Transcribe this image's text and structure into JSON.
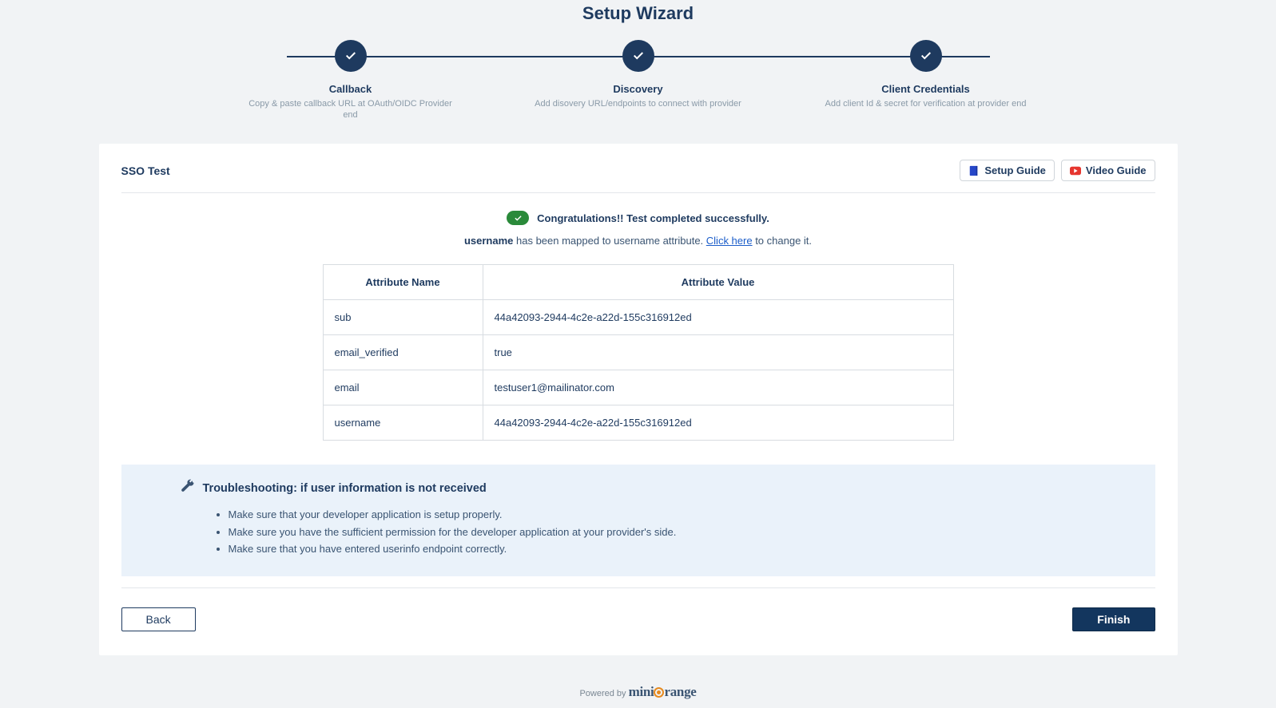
{
  "wizard": {
    "title": "Setup Wizard",
    "steps": [
      {
        "title": "Callback",
        "desc": "Copy & paste callback URL at OAuth/OIDC Provider end"
      },
      {
        "title": "Discovery",
        "desc": "Add disovery URL/endpoints to connect with provider"
      },
      {
        "title": "Client Credentials",
        "desc": "Add client Id & secret for verification at provider end"
      }
    ]
  },
  "panel": {
    "title": "SSO Test",
    "setup_guide_label": "Setup Guide",
    "video_guide_label": "Video Guide",
    "success_text": "Congratulations!! Test completed successfully.",
    "mapping_prefix_bold": "username",
    "mapping_middle": " has been mapped to username attribute. ",
    "mapping_link": "Click here",
    "mapping_suffix": " to change it."
  },
  "table": {
    "header_name": "Attribute Name",
    "header_value": "Attribute Value",
    "rows": [
      {
        "name": "sub",
        "value": "44a42093-2944-4c2e-a22d-155c316912ed"
      },
      {
        "name": "email_verified",
        "value": "true"
      },
      {
        "name": "email",
        "value": "testuser1@mailinator.com"
      },
      {
        "name": "username",
        "value": "44a42093-2944-4c2e-a22d-155c316912ed"
      }
    ]
  },
  "troubleshoot": {
    "title": "Troubleshooting: if user information is not received",
    "items": [
      "Make sure that your developer application is setup properly.",
      "Make sure you have the sufficient permission for the developer application at your provider's side.",
      "Make sure that you have entered userinfo endpoint correctly."
    ]
  },
  "footer": {
    "back": "Back",
    "finish": "Finish",
    "powered_prefix": "Powered by ",
    "brand_pre": "mini",
    "brand_post": "range"
  }
}
